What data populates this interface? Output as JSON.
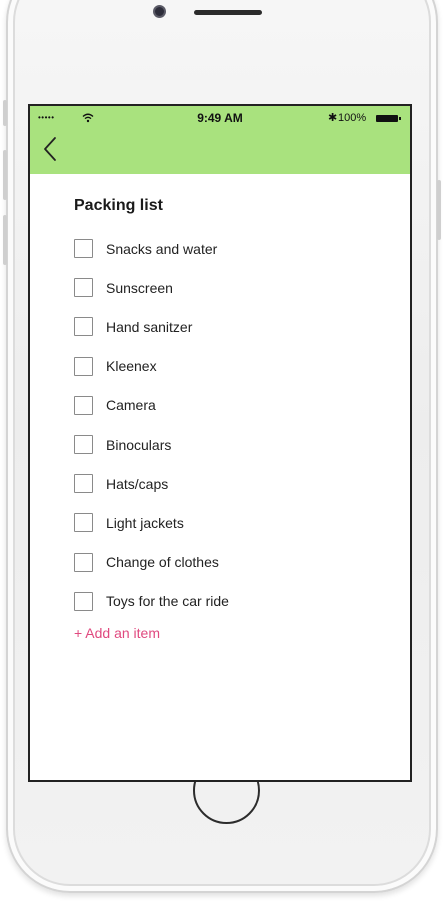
{
  "status_bar": {
    "signal": "•••••",
    "time": "9:49 AM",
    "bluetooth": "✱",
    "battery_level": "100%"
  },
  "nav": {
    "back_icon": "chevron-left-icon",
    "background_color": "#a9e27e"
  },
  "packing_list": {
    "title": "Packing list",
    "items": [
      {
        "label": "Snacks and water",
        "checked": false
      },
      {
        "label": "Sunscreen",
        "checked": false
      },
      {
        "label": "Hand sanitzer",
        "checked": false
      },
      {
        "label": "Kleenex",
        "checked": false
      },
      {
        "label": "Camera",
        "checked": false
      },
      {
        "label": "Binoculars",
        "checked": false
      },
      {
        "label": "Hats/caps",
        "checked": false
      },
      {
        "label": "Light jackets",
        "checked": false
      },
      {
        "label": "Change of clothes",
        "checked": false
      },
      {
        "label": "Toys for the car ride",
        "checked": false
      }
    ],
    "add_item_label": "+ Add an item",
    "add_item_color": "#e0497f"
  }
}
